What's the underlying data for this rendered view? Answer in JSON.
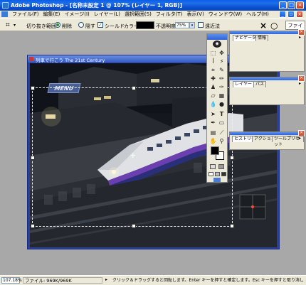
{
  "app": {
    "title": "Adobe Photoshop - [名称未設定 1 @ 107% (レイヤー 1, RGB)]",
    "min": "_",
    "max": "□",
    "close": "×"
  },
  "menu": [
    "ファイル(F)",
    "編集(E)",
    "イメージ(I)",
    "レイヤー(L)",
    "選択範囲(S)",
    "フィルタ(T)",
    "表示(V)",
    "ウィンドウ(W)",
    "ヘルプ(H)"
  ],
  "options": {
    "crop_label": "切り抜き範囲:",
    "delete_label": "削除",
    "hide_label": "隠す",
    "shield_label": "シールド",
    "color_label": "カラー:",
    "opacity_label": "不透明度:",
    "opacity_value": "75%",
    "perspective_label": "遠近法",
    "cancel_icon": "×",
    "commit_icon": "○",
    "file_tab": "ファイル"
  },
  "document": {
    "title": "列車で行こう The 21st Century",
    "menu_badge": "MENU"
  },
  "panels": {
    "navigator": {
      "tabs": [
        "ナビゲータ",
        "情報"
      ]
    },
    "layers": {
      "tabs": [
        "レイヤー",
        "パス"
      ]
    },
    "history": {
      "tabs": [
        "ヒストリー",
        "アクション",
        "ツールプリセット"
      ]
    }
  },
  "status": {
    "zoom": "107.18%",
    "file_info": "ファイル: 969K/969K",
    "hint": "クリック＆ドラッグすると回転します。Enter キーを押すと確定します。Esc キーを押すと取り消します。スペースバーを"
  },
  "colors": {
    "foreground": "#000000",
    "background": "#ffffff",
    "xp_blue": "#0a5fe8"
  }
}
